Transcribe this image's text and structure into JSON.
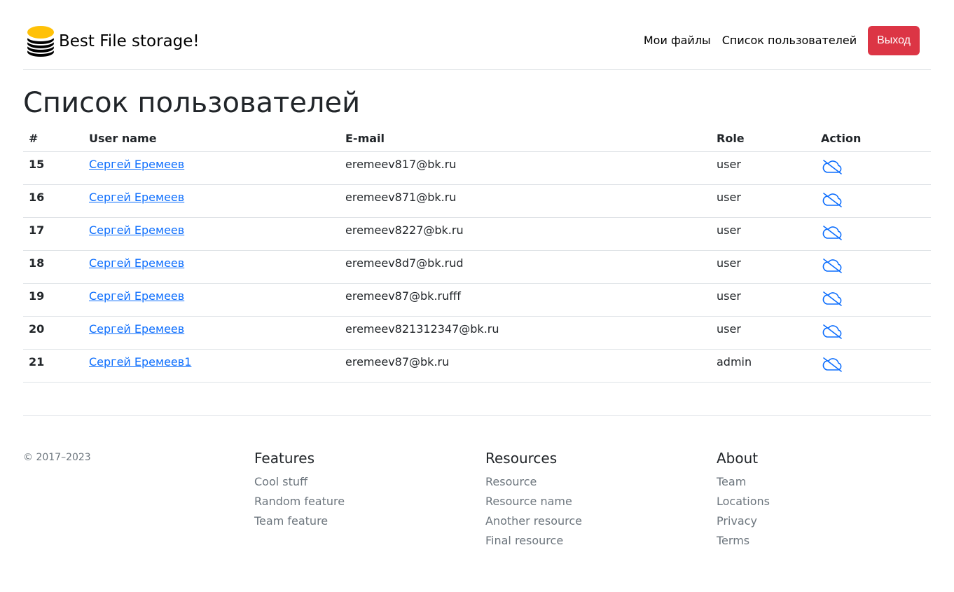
{
  "header": {
    "brand": "Best File storage!",
    "nav": [
      "Мои файлы",
      "Список пользователей"
    ],
    "logout": "Выход"
  },
  "page_title": "Список пользователей",
  "table": {
    "headers": [
      "#",
      "User name",
      "E-mail",
      "Role",
      "Action"
    ],
    "rows": [
      {
        "id": "15",
        "name": "Сергей Еремеев",
        "email": "eremeev817@bk.ru",
        "role": "user"
      },
      {
        "id": "16",
        "name": "Сергей Еремеев",
        "email": "eremeev871@bk.ru",
        "role": "user"
      },
      {
        "id": "17",
        "name": "Сергей Еремеев",
        "email": "eremeev8227@bk.ru",
        "role": "user"
      },
      {
        "id": "18",
        "name": "Сергей Еремеев",
        "email": "eremeev8d7@bk.rud",
        "role": "user"
      },
      {
        "id": "19",
        "name": "Сергей Еремеев",
        "email": "eremeev87@bk.rufff",
        "role": "user"
      },
      {
        "id": "20",
        "name": "Сергей Еремеев",
        "email": "eremeev821312347@bk.ru",
        "role": "user"
      },
      {
        "id": "21",
        "name": "Сергей Еремеев1",
        "email": "eremeev87@bk.ru",
        "role": "admin"
      }
    ],
    "action_icon": "cloud-slash-icon"
  },
  "footer": {
    "copyright": "© 2017–2023",
    "columns": [
      {
        "title": "Features",
        "links": [
          "Cool stuff",
          "Random feature",
          "Team feature"
        ]
      },
      {
        "title": "Resources",
        "links": [
          "Resource",
          "Resource name",
          "Another resource",
          "Final resource"
        ]
      },
      {
        "title": "About",
        "links": [
          "Team",
          "Locations",
          "Privacy",
          "Terms"
        ]
      }
    ]
  },
  "colors": {
    "link": "#0d6efd",
    "danger": "#dc3545",
    "muted": "#6c757d",
    "brand_top": "#ffc107"
  }
}
